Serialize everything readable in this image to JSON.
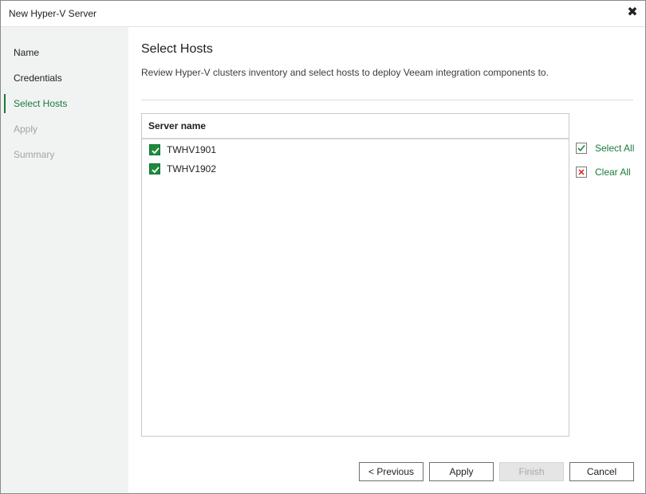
{
  "window": {
    "title": "New Hyper-V Server",
    "close_glyph": "✖"
  },
  "sidebar": {
    "items": [
      {
        "label": "Name",
        "state": "normal"
      },
      {
        "label": "Credentials",
        "state": "normal"
      },
      {
        "label": "Select Hosts",
        "state": "active"
      },
      {
        "label": "Apply",
        "state": "disabled"
      },
      {
        "label": "Summary",
        "state": "disabled"
      }
    ]
  },
  "main": {
    "heading": "Select Hosts",
    "description": "Review Hyper-V clusters inventory and select hosts to deploy Veeam integration components to.",
    "list": {
      "column_header": "Server name",
      "rows": [
        {
          "label": "TWHV1901",
          "checked": true
        },
        {
          "label": "TWHV1902",
          "checked": true
        }
      ]
    },
    "actions": {
      "select_all": "Select All",
      "clear_all": "Clear All"
    }
  },
  "footer": {
    "previous": "< Previous",
    "apply": "Apply",
    "finish": "Finish",
    "cancel": "Cancel"
  },
  "colors": {
    "accent": "#1a7a3c",
    "checkbox": "#1e8a3e",
    "sidebar_bg": "#f1f3f2",
    "disabled_text": "#a3a3a3"
  }
}
